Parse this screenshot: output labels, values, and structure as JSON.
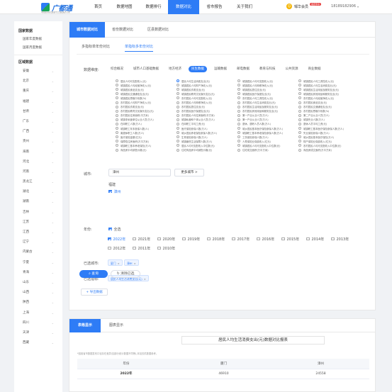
{
  "app": {
    "logo_text": "广都通",
    "logo_sub": "中国城市研究数据平台 数据服务专家"
  },
  "nav": [
    "首页",
    "数据地图",
    "数据排行",
    "数据对比",
    "省市报告",
    "关于我们"
  ],
  "nav_active": 3,
  "user": {
    "name": "邹华会员",
    "badge": "会员专享",
    "phone": "18189182906"
  },
  "sidebar": {
    "national_head": "国家数据",
    "national_items": [
      "国家年度数据",
      "国家月度数据"
    ],
    "regional_head": "区域数据",
    "regions": [
      "安徽",
      "北京",
      "重庆",
      "福建",
      "甘肃",
      "广东",
      "广西",
      "贵州",
      "海南",
      "河北",
      "河南",
      "黑龙江",
      "湖北",
      "湖南",
      "吉林",
      "江苏",
      "江西",
      "辽宁",
      "内蒙古",
      "宁夏",
      "青海",
      "山东",
      "山西",
      "陕西",
      "上海",
      "四川",
      "天津",
      "西藏"
    ]
  },
  "tabs": [
    "城市数据对比",
    "省份数据对比",
    "区县数据对比"
  ],
  "subtabs": [
    "多指标单年份对比",
    "单指标多年份对比"
  ],
  "dimension_label": "数据维度:",
  "dimensions": [
    "综合概况",
    "城市人口基础数据",
    "地方经济",
    "民生数据",
    "运输数据",
    "邮电数据",
    "教育与科技",
    "公共资源",
    "商业数据"
  ],
  "dimension_active": 3,
  "metrics": [
    "居民人均可支配收入(元)",
    "居民人均生活消费支出(元)",
    "城镇居民人均可支配收入(元)",
    "城镇居民人均工资性收入(元)",
    "城镇居民人均经营净收入(元)",
    "城镇居民人均财产净收入(元)",
    "城镇居民人均转移净收入(元)",
    "城镇居民人均生活消费支出(元)",
    "城镇居民食品支出(元)",
    "城镇居民衣着支出(元)",
    "城镇居民居住支出(元)",
    "城镇居民生活用品及服务支出(元)",
    "城镇居民交通通信支出(元)",
    "城镇居民教育文化娱乐支出(元)",
    "城镇居民医疗保健支出(元)",
    "城镇居民其他用品和服务支出(元)",
    "城镇居民恩格尔系数(%)",
    "农村居民人均可支配收入(元)",
    "农村居民人均工资性收入(元)",
    "农村居民人均经营净收入(元)",
    "农村居民人均财产净收入(元)",
    "农村居民人均转移净收入(元)",
    "农村居民人均生活消费支出(元)",
    "农村居民食品支出(元)",
    "农村居民衣着支出(元)",
    "农村居民居住支出(元)",
    "农村居民生活用品及服务支出(元)",
    "农村居民交通通信支出(元)",
    "农村居民教育文化娱乐支出(元)",
    "农村居民医疗保健支出(元)",
    "农村居民其他用品和服务支出(元)",
    "农村居民恩格尔系数(%)",
    "农村居民住房面积(平方米)",
    "农村居民人均住房面积(平方米)",
    "第一产业从业人员(万人)",
    "第二产业从业人员(万人)",
    "城镇非私营单位从业人员(万人)",
    "城镇私营和个体从业人员(万人)",
    "第一产业从业人员(万人)",
    "城镇失业人数(万人)",
    "在岗职工人数(万人)",
    "在岗职工平均工资(元)",
    "退休、退职人员人数(万人)",
    "退休人员平均工资(元)",
    "城镇职工年末参保人数(人)",
    "医疗保险参保人数(万人)",
    "城乡居民基本医疗保险参保人数(万人)",
    "城镇职工基本医疗保险参保人数(万人)",
    "离退休职工人数(万人)",
    "城乡居民养老保险参保人数(万人)",
    "城镇职工基本养老保险参保人数(万人)",
    "失业保险参保人数(万人)",
    "医疗保险金额(亿元)",
    "生育保险参保人数(万人)",
    "工伤保险参保人数(万人)",
    "城乡居民基本医疗保险(万人)",
    "保障性住房面积(万平方米)",
    "城镇最低生活保障人数(万人)",
    "人寿保险业保费收入(亿元)",
    "财产保险业保费收入(亿元)",
    "城镇职工基本养老保险(万人)",
    "居民人均可支配收入中位数(元)",
    "城镇居民人均可支配收入中位数(元)",
    "农村居民人均可支配收入中位数(元)",
    "商品房平均销售价格(元)",
    "住宅商品房平均销售价格(元)",
    "住宅成交面积(万平方米)",
    "商品房成交面积(万平方米)"
  ],
  "metric_active": 1,
  "city_label": "城市:",
  "city_search_value": "漳州",
  "more_cities": "更多城市 >",
  "province_name": "福建",
  "city_option": "漳州",
  "year_label": "年份:",
  "all_label": "全选",
  "years": [
    "2022年",
    "2021年",
    "2020年",
    "2019年",
    "2018年",
    "2017年",
    "2016年",
    "2015年",
    "2014年",
    "2013年",
    "2012年",
    "2011年",
    "2010年"
  ],
  "selected_cities_label": "已选城市:",
  "selected_cities": [
    "厦门",
    "漳州"
  ],
  "selected_metrics_label": "已选指标:",
  "selected_metrics": [
    "居民人均生活消费支出(元)"
  ],
  "query_btn": "查询",
  "clear_btn": "清除已选",
  "export_btn": "导出数据",
  "result_tabs": [
    "表格显示",
    "图表显示"
  ],
  "report_title": "居民人均生活消费支出(元)数据对比报表",
  "note": "*因各省市数据发布口径存在差异(如部分统计数据不同等),本站仅供数据参考。",
  "table": {
    "headers": [
      "年份",
      "厦门",
      "漳州"
    ],
    "rows": [
      [
        "2022年",
        "46910",
        "24558"
      ]
    ]
  }
}
